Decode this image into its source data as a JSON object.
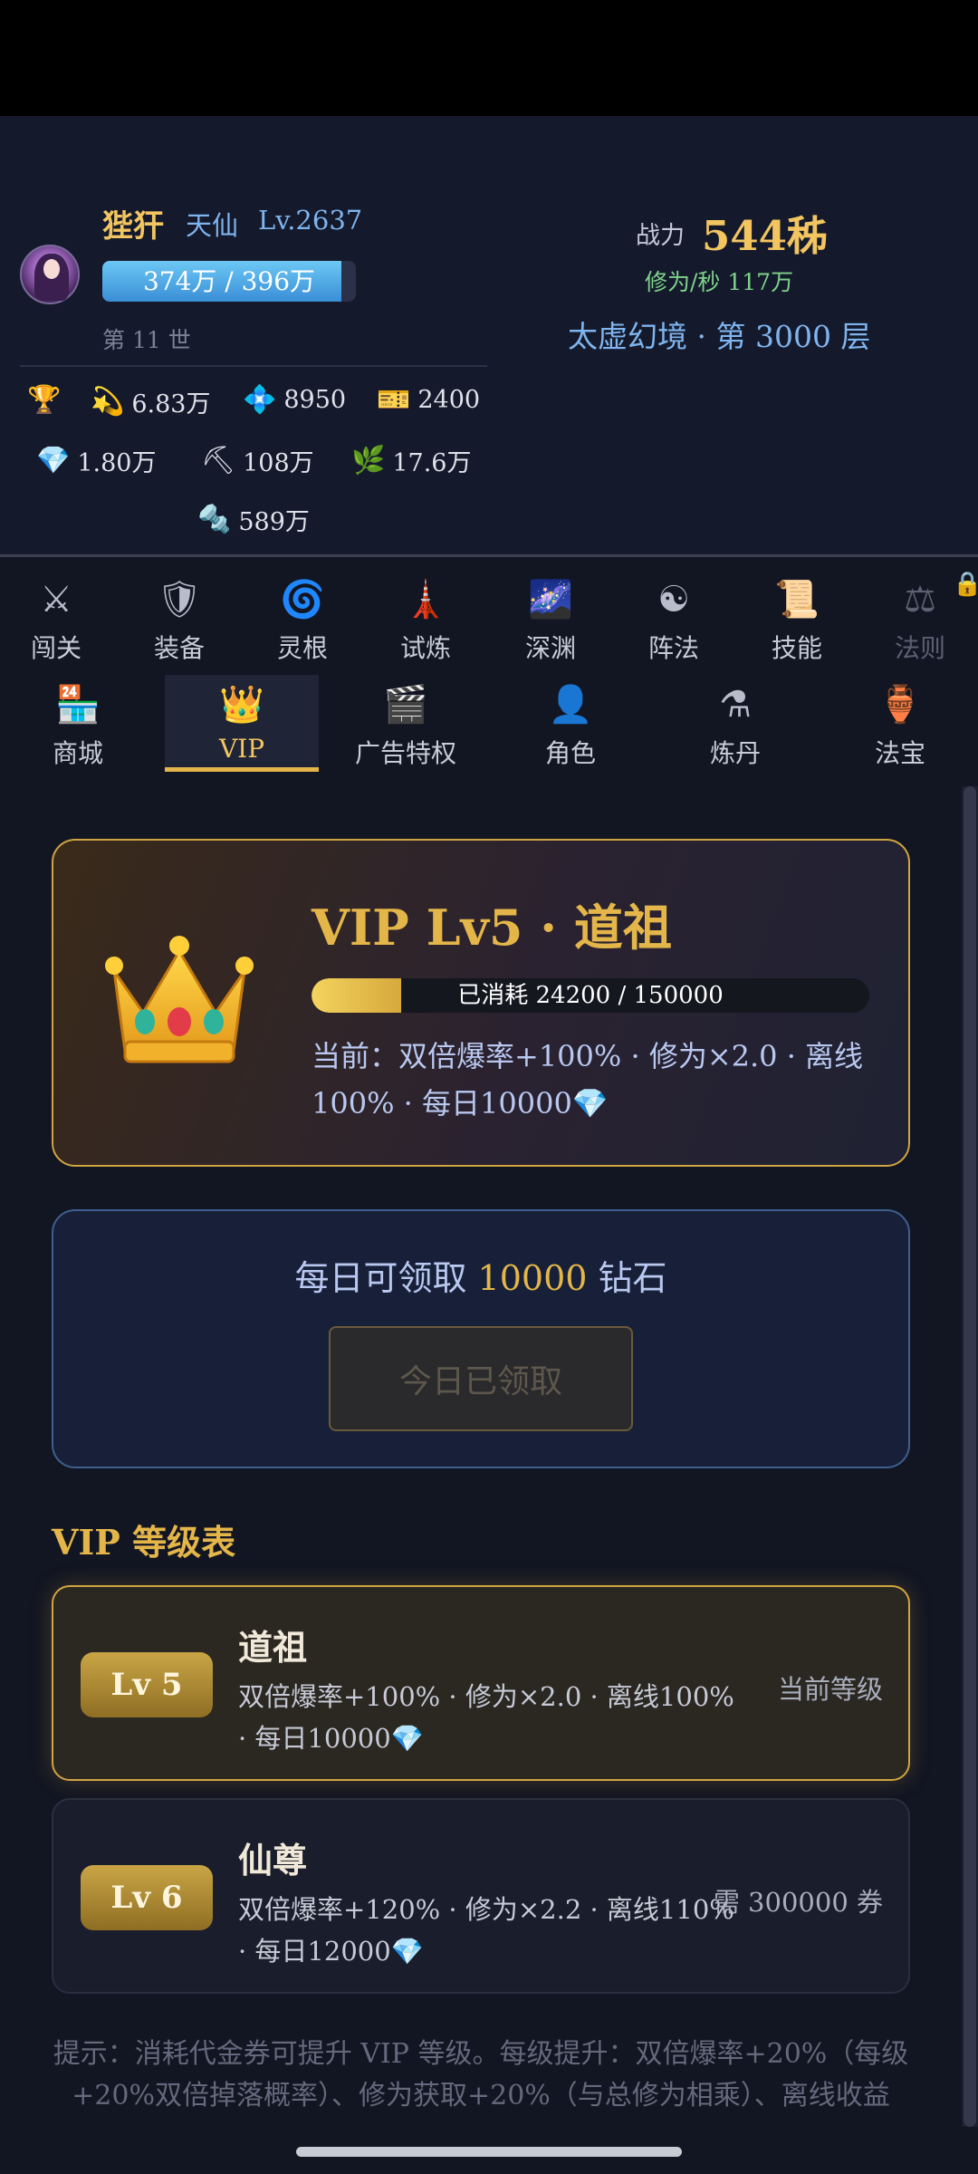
{
  "player": {
    "name": "狴犴",
    "realm": "天仙",
    "level": "Lv.2637",
    "xp_text": "374万 / 396万",
    "xp_progress": 0.944,
    "generation": "第 11 世",
    "power_label": "战力",
    "power_value": "544秭",
    "cultivation_rate": "修为/秒 117万",
    "tower": "太虚幻境 · 第 3000 层"
  },
  "resources": [
    {
      "icon": "trophy-icon",
      "glyph": "🏆",
      "value": ""
    },
    {
      "icon": "shooting-star-icon",
      "glyph": "💫",
      "value": "6.83万"
    },
    {
      "icon": "blue-crystal-icon",
      "glyph": "💠",
      "value": "8950"
    },
    {
      "icon": "ticket-icon",
      "glyph": "🎫",
      "value": "2400"
    },
    {
      "icon": "diamond-icon",
      "glyph": "💎",
      "value": "1.80万"
    },
    {
      "icon": "pickaxe-icon",
      "glyph": "⛏",
      "value": "108万"
    },
    {
      "icon": "herb-icon",
      "glyph": "🌿",
      "value": "17.6万"
    },
    {
      "icon": "gear-icon",
      "glyph": "🔩",
      "value": "589万"
    }
  ],
  "nav_row1": [
    {
      "label": "闯关",
      "icon": "swords-icon",
      "glyph": "⚔"
    },
    {
      "label": "装备",
      "icon": "shield-icon",
      "glyph": "🛡"
    },
    {
      "label": "灵根",
      "icon": "cyclone-icon",
      "glyph": "🌀"
    },
    {
      "label": "试炼",
      "icon": "tower-icon",
      "glyph": "🗼"
    },
    {
      "label": "深渊",
      "icon": "galaxy-icon",
      "glyph": "🌌"
    },
    {
      "label": "阵法",
      "icon": "yin-yang-icon",
      "glyph": "☯"
    },
    {
      "label": "技能",
      "icon": "scroll-icon",
      "glyph": "📜"
    },
    {
      "label": "法则",
      "icon": "scales-icon",
      "glyph": "⚖"
    }
  ],
  "nav_row2": [
    {
      "label": "商城",
      "icon": "shop-icon",
      "glyph": "🏪"
    },
    {
      "label": "VIP",
      "icon": "crown-icon",
      "glyph": "👑"
    },
    {
      "label": "广告特权",
      "icon": "clapper-icon",
      "glyph": "🎬"
    },
    {
      "label": "角色",
      "icon": "person-icon",
      "glyph": "👤"
    },
    {
      "label": "炼丹",
      "icon": "alembic-icon",
      "glyph": "⚗"
    },
    {
      "label": "法宝",
      "icon": "vase-icon",
      "glyph": "🏺"
    }
  ],
  "lock_glyph": "🔒",
  "vip": {
    "title": "VIP Lv5 · 道祖",
    "spent_text": "已消耗 24200 / 150000",
    "spent_progress": 0.161,
    "benefits": "当前：双倍爆率+100% · 修为×2.0 · 离线100% · 每日10000💎"
  },
  "daily": {
    "text_before": "每日可领取 ",
    "amount": "10000",
    "text_after": " 钻石",
    "button": "今日已领取"
  },
  "table": {
    "title": "VIP 等级表",
    "tiers": [
      {
        "badge": "Lv 5",
        "name": "道祖",
        "desc": "双倍爆率+100% · 修为×2.0 · 离线100% · 每日10000💎",
        "status": "当前等级"
      },
      {
        "badge": "Lv 6",
        "name": "仙尊",
        "desc": "双倍爆率+120% · 修为×2.2 · 离线110% · 每日12000💎",
        "status": "需 300000 券"
      }
    ]
  },
  "hint": "提示：消耗代金券可提升 VIP 等级。每级提升：双倍爆率+20%（每级+20%双倍掉落概率）、修为获取+20%（与总修为相乘）、离线收益",
  "colors": {
    "gold": "#e4b64a",
    "blue": "#7fb4ee",
    "green": "#7fd38a"
  }
}
